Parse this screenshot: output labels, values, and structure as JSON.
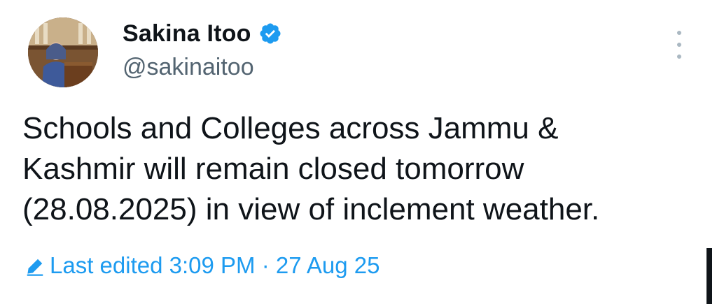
{
  "tweet": {
    "author": {
      "display_name": "Sakina Itoo",
      "handle": "@sakinaitoo",
      "verified": true,
      "verified_icon": "verified-badge-icon"
    },
    "menu_icon": "more-options-icon",
    "text": "Schools and Colleges across Jammu &\nKashmir will remain closed tomorrow\n(28.08.2025) in view of inclement weather.",
    "edit_info": {
      "icon": "pencil-icon",
      "label": "Last edited 3:09 PM · 27 Aug 25"
    }
  },
  "colors": {
    "text": "#0f1419",
    "secondary": "#536471",
    "accent": "#1d9bf0"
  }
}
